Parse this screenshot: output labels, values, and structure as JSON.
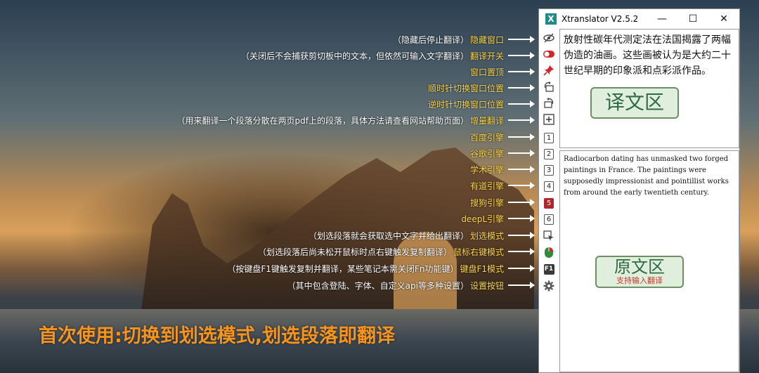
{
  "window": {
    "title": "Xtranslator V2.5.2",
    "app_icon_letter": "X",
    "minimize": "—",
    "maximize": "☐",
    "close": "✕"
  },
  "labels": [
    {
      "desc": "（隐藏后停止翻译）",
      "name": "隐藏窗口"
    },
    {
      "desc": "（关闭后不会捕获剪切板中的文本，但依然可输入文字翻译）",
      "name": "翻译开关"
    },
    {
      "desc": "",
      "name": "窗口置顶"
    },
    {
      "desc": "",
      "name": "顺时针切换窗口位置"
    },
    {
      "desc": "",
      "name": "逆时针切换窗口位置"
    },
    {
      "desc": "（用来翻译一个段落分散在两页pdf上的段落，具体方法请查看网站帮助页面）",
      "name": "增量翻译"
    },
    {
      "desc": "",
      "name": "百度引擎"
    },
    {
      "desc": "",
      "name": "谷歌引擎"
    },
    {
      "desc": "",
      "name": "学术引擎"
    },
    {
      "desc": "",
      "name": "有道引擎"
    },
    {
      "desc": "",
      "name": "搜狗引擎"
    },
    {
      "desc": "",
      "name": "deepL引擎"
    },
    {
      "desc": "（划选段落就会获取选中文字并给出翻译）",
      "name": "划选模式"
    },
    {
      "desc": "（划选段落后尚未松开鼠标时点右键触发复制翻译）",
      "name": "鼠标右键模式"
    },
    {
      "desc": "（按键盘F1键触发复制并翻译，某些笔记本需关闭Fn功能键）",
      "name": "键盘F1模式"
    },
    {
      "desc": "（其中包含登陆、字体、自定义api等多种设置）",
      "name": "设置按钮"
    }
  ],
  "banner": "首次使用:切换到划选模式,划选段落即翻译",
  "toolbar": {
    "icons": [
      "eye-slash-icon",
      "toggle-icon",
      "pin-icon",
      "rotate-clockwise-icon",
      "rotate-counterclockwise-icon",
      "plus-square-icon"
    ],
    "engines": [
      "1",
      "2",
      "3",
      "4",
      "5",
      "6"
    ],
    "active_engine": "5",
    "mode_icons": [
      "select-cursor-icon",
      "mouse-icon",
      "f1-key-icon",
      "gear-icon"
    ],
    "f1_label": "F1"
  },
  "translation": {
    "text": "放射性碳年代测定法在法国揭露了两幅伪造的油画。这些画被认为是大约二十世纪早期的印象派和点彩派作品。",
    "zone_label": "译文区"
  },
  "source": {
    "text": "Radiocarbon dating has unmasked two forged paintings in France. The paintings were supposedly impressionist and pointillist works from around the early twentieth century.",
    "zone_label": "原文区",
    "zone_sublabel": "支持输入翻译"
  },
  "colors": {
    "label_name": "#ffd84d",
    "banner": "#f7941d",
    "active_engine": "#b3252c",
    "zone_border": "#6c8f63",
    "zone_fill": "#dfeedd"
  }
}
